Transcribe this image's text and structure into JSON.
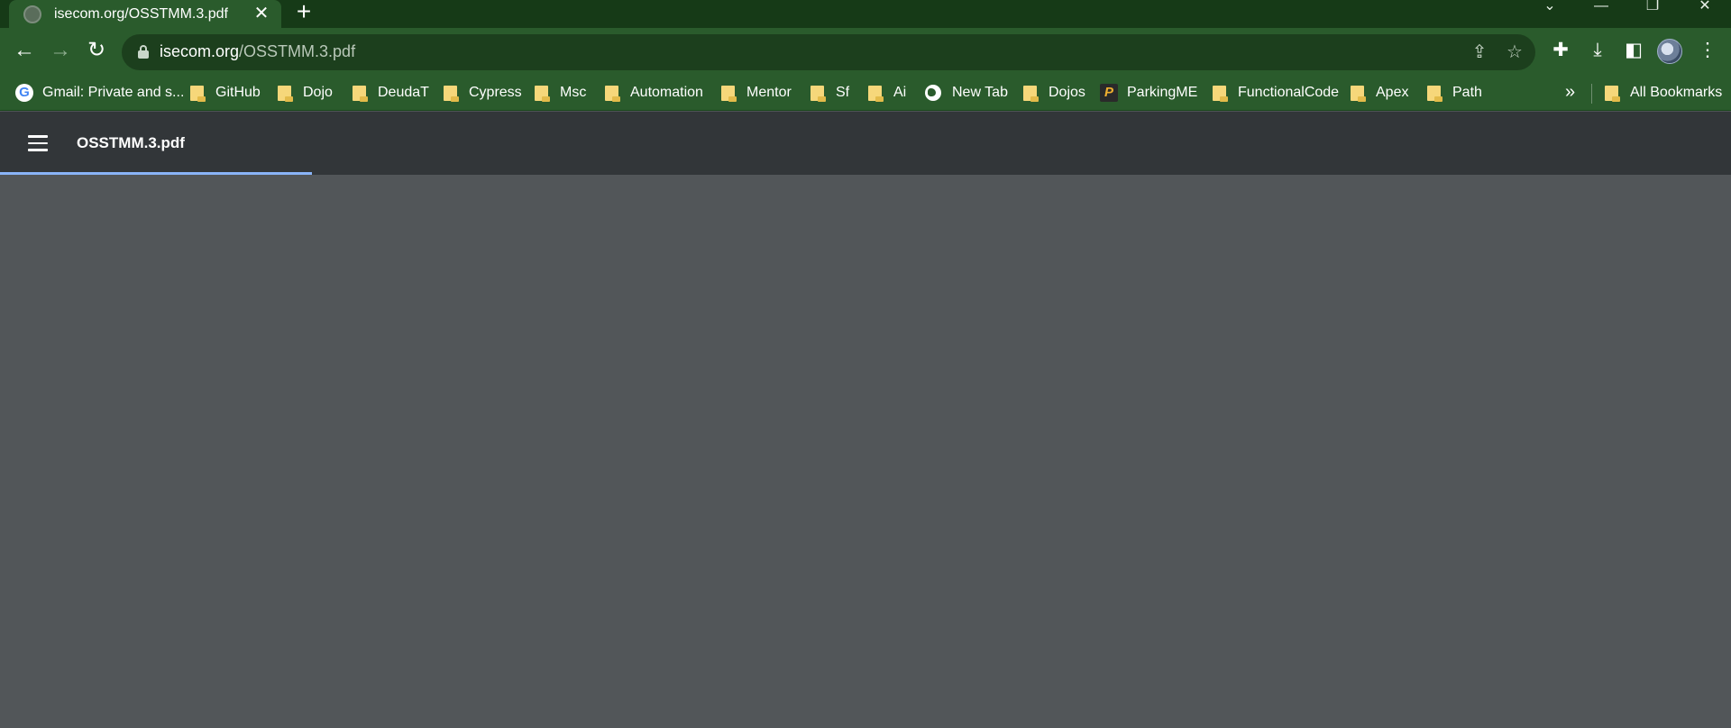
{
  "browser": {
    "tab": {
      "title": "isecom.org/OSSTMM.3.pdf",
      "close_glyph": "✕"
    },
    "new_tab_glyph": "+",
    "window_controls": [
      "⌄",
      "—",
      "❐",
      "✕"
    ],
    "nav": {
      "back": "←",
      "forward": "→",
      "reload": "↻"
    },
    "address": {
      "domain": "isecom.org",
      "path": "/OSSTMM.3.pdf"
    },
    "omnibox_icons": [
      "share-icon",
      "star-icon"
    ],
    "toolbar_icons": [
      "extensions-icon",
      "download-icon",
      "side-panel-icon",
      "avatar",
      "kebab-menu-icon"
    ]
  },
  "bookmarks": {
    "items": [
      {
        "label": "Gmail: Private and s...",
        "icon": "google-icon"
      },
      {
        "label": "GitHub",
        "icon": "folder-icon"
      },
      {
        "label": "Dojo",
        "icon": "folder-icon"
      },
      {
        "label": "DeudaT",
        "icon": "folder-icon"
      },
      {
        "label": "Cypress",
        "icon": "folder-icon"
      },
      {
        "label": "Msc",
        "icon": "folder-icon"
      },
      {
        "label": "Automation",
        "icon": "folder-icon"
      },
      {
        "label": "Mentor",
        "icon": "folder-icon"
      },
      {
        "label": "Sf",
        "icon": "folder-icon"
      },
      {
        "label": "Ai",
        "icon": "folder-icon"
      },
      {
        "label": "New Tab",
        "icon": "globe-icon"
      },
      {
        "label": "Dojos",
        "icon": "folder-icon"
      },
      {
        "label": "ParkingME",
        "icon": "parkingme-icon"
      },
      {
        "label": "FunctionalCode",
        "icon": "folder-icon"
      },
      {
        "label": "Apex",
        "icon": "folder-icon"
      },
      {
        "label": "Path",
        "icon": "folder-icon"
      }
    ],
    "overflow_glyph": "»",
    "all_bookmarks": "All Bookmarks"
  },
  "pdf_viewer": {
    "title": "OSSTMM.3.pdf",
    "loading_progress_fraction": 0.18
  },
  "colors": {
    "theme_green": "#2a5b2c",
    "frame_dark_green": "#163a17",
    "pdf_toolbar": "#323639",
    "viewer_bg": "#525659",
    "progress_blue": "#8ab4f8"
  }
}
